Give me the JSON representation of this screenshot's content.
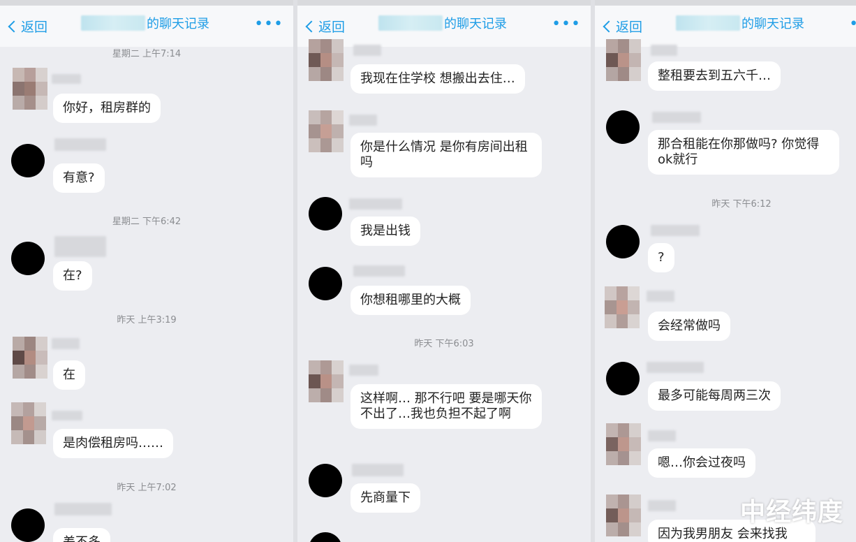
{
  "panels": [
    {
      "back_label": "返回",
      "title_suffix": "的聊天记录",
      "more_label": "•••",
      "items": [
        {
          "type": "ts",
          "text": "星期二 上午7:14"
        },
        {
          "type": "msg",
          "avatar": "pixel",
          "text": "你好，租房群的"
        },
        {
          "type": "msg",
          "avatar": "black",
          "text": "有意?"
        },
        {
          "type": "ts",
          "text": "星期二 下午6:42"
        },
        {
          "type": "msg",
          "avatar": "black",
          "text": "在?"
        },
        {
          "type": "ts",
          "text": "昨天 上午3:19"
        },
        {
          "type": "msg",
          "avatar": "pixel",
          "text": "在"
        },
        {
          "type": "msg",
          "avatar": "pixel",
          "text": "是肉偿租房吗……"
        },
        {
          "type": "ts",
          "text": "昨天 上午7:02"
        },
        {
          "type": "msg",
          "avatar": "black",
          "text": "差不多"
        }
      ]
    },
    {
      "back_label": "返回",
      "title_suffix": "的聊天记录",
      "more_label": "•••",
      "items": [
        {
          "type": "msg",
          "avatar": "pixel",
          "text": "我现在住学校 想搬出去住…"
        },
        {
          "type": "msg",
          "avatar": "pixel",
          "text": "你是什么情况 是你有房间出租吗"
        },
        {
          "type": "msg",
          "avatar": "black",
          "text": "我是出钱"
        },
        {
          "type": "msg",
          "avatar": "black",
          "text": "你想租哪里的大概"
        },
        {
          "type": "ts",
          "text": "昨天 下午6:03"
        },
        {
          "type": "msg",
          "avatar": "pixel",
          "text": "这样啊… 那不行吧 要是哪天你不出了…我也负担不起了啊"
        },
        {
          "type": "msg",
          "avatar": "black",
          "text": "先商量下"
        }
      ]
    },
    {
      "back_label": "返回",
      "title_suffix": "的聊天记录",
      "more_label": "•••",
      "items": [
        {
          "type": "msg",
          "avatar": "pixel",
          "text": "整租要去到五六千…"
        },
        {
          "type": "msg",
          "avatar": "black",
          "text": "那合租能在你那做吗? 你觉得ok就行"
        },
        {
          "type": "ts",
          "text": "昨天 下午6:12"
        },
        {
          "type": "msg",
          "avatar": "black",
          "text": "?"
        },
        {
          "type": "msg",
          "avatar": "pixel",
          "text": "会经常做吗"
        },
        {
          "type": "msg",
          "avatar": "black",
          "text": "最多可能每周两三次"
        },
        {
          "type": "msg",
          "avatar": "pixel",
          "text": "嗯…你会过夜吗"
        },
        {
          "type": "msg",
          "avatar": "pixel",
          "text": "因为我男朋友 会来找我"
        }
      ]
    }
  ],
  "watermark": "中经纬度",
  "colors": {
    "accent": "#1e9de6",
    "background": "#ecedf1",
    "bubble": "#ffffff"
  }
}
